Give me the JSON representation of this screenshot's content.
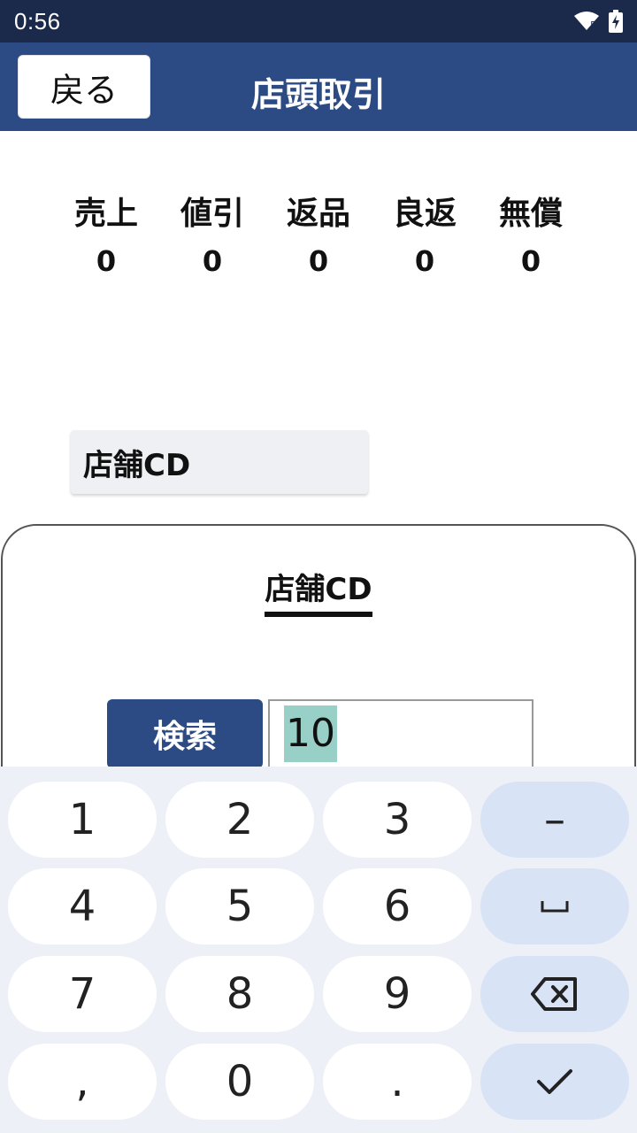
{
  "status_bar": {
    "time": "0:56"
  },
  "app_bar": {
    "back_label": "戻る",
    "title": "店頭取引"
  },
  "counters": [
    {
      "label": "売上",
      "value": "0"
    },
    {
      "label": "値引",
      "value": "0"
    },
    {
      "label": "返品",
      "value": "0"
    },
    {
      "label": "良返",
      "value": "0"
    },
    {
      "label": "無償",
      "value": "0"
    }
  ],
  "store_field": {
    "label": "店舗CD"
  },
  "dialog": {
    "title": "店舗CD",
    "search_label": "検索",
    "input_value": "10"
  },
  "keyboard": {
    "keys": [
      "1",
      "2",
      "3",
      "–",
      "4",
      "5",
      "6",
      "␣",
      "7",
      "8",
      "9",
      "⌫",
      ",",
      "0",
      ".",
      "✓"
    ]
  },
  "colors": {
    "status_bar": "#1b2a4b",
    "app_bar": "#2c4a84",
    "selection": "#98cfc6",
    "keyboard_bg": "#eef0f8",
    "function_key": "#d9e3f6"
  }
}
